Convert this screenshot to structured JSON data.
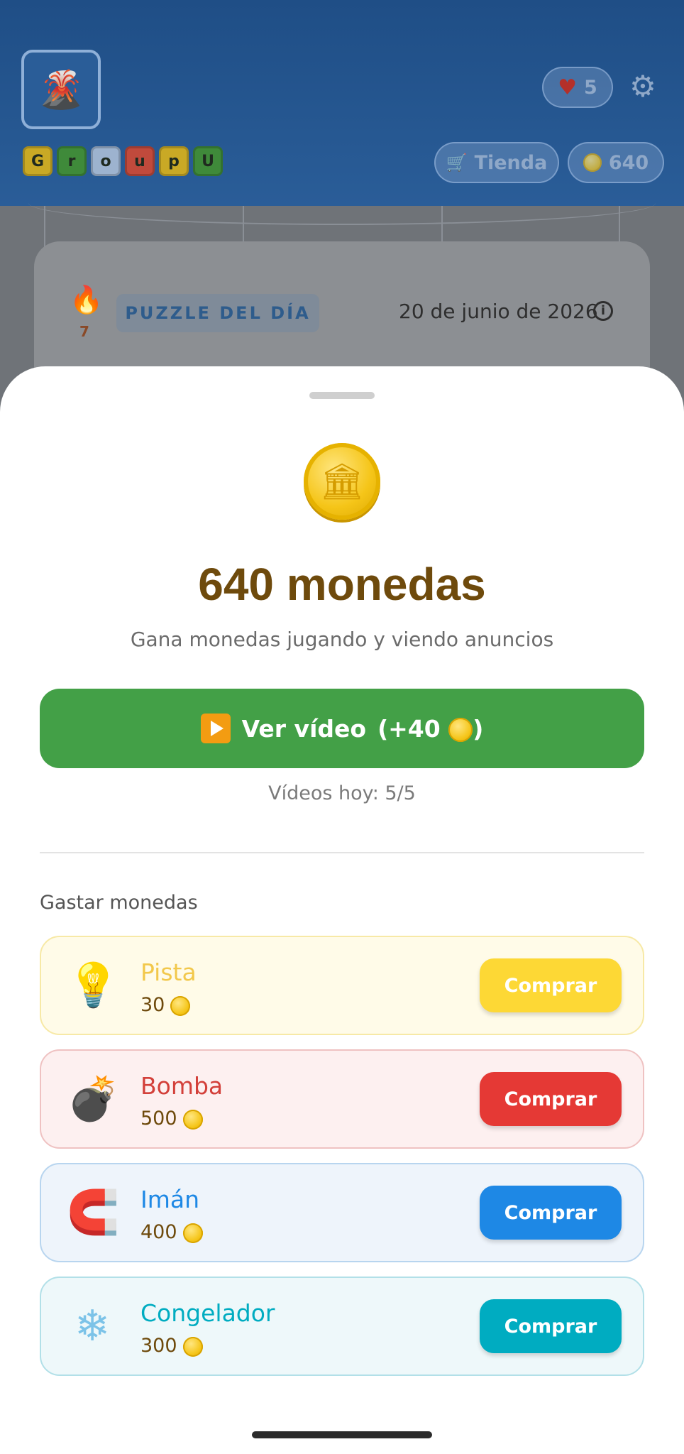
{
  "header": {
    "avatar_icon": "volcano-icon",
    "logo_letters": [
      {
        "letter": "G",
        "color": "#c9a925"
      },
      {
        "letter": "r",
        "color": "#3f8a3a"
      },
      {
        "letter": "o",
        "color": "#9db3cf"
      },
      {
        "letter": "u",
        "color": "#c04a3c"
      },
      {
        "letter": "p",
        "color": "#c9a925"
      },
      {
        "letter": "U",
        "color": "#3f8a3a"
      }
    ],
    "lives": "5",
    "shop_label": "Tienda",
    "coins": "640"
  },
  "puzzle_card": {
    "streak": "7",
    "badge": "PUZZLE DEL DÍA",
    "date": "20 de junio de 2026"
  },
  "sheet": {
    "title": "640 monedas",
    "subtitle": "Gana monedas jugando y viendo anuncios",
    "video_button_main": "Ver vídeo",
    "video_button_reward": "(+40",
    "video_button_close": ")",
    "videos_today": "Vídeos hoy: 5/5",
    "spend_label": "Gastar monedas",
    "items": [
      {
        "name": "Pista",
        "price": "30",
        "buy": "Comprar",
        "icon": "lightbulb-icon",
        "color": "#f2c84b",
        "bg": "#fffbe8",
        "border": "#f7e9a6",
        "btn": "#fdd835"
      },
      {
        "name": "Bomba",
        "price": "500",
        "buy": "Comprar",
        "icon": "bomb-icon",
        "color": "#d3403a",
        "bg": "#fdf0f0",
        "border": "#efc2c2",
        "btn": "#e53935"
      },
      {
        "name": "Imán",
        "price": "400",
        "buy": "Comprar",
        "icon": "magnet-icon",
        "color": "#1e88e5",
        "bg": "#eef4fb",
        "border": "#b8d5ef",
        "btn": "#1e88e5"
      },
      {
        "name": "Congelador",
        "price": "300",
        "buy": "Comprar",
        "icon": "snowflake-icon",
        "color": "#00acc1",
        "bg": "#eef8fa",
        "border": "#b2e0e8",
        "btn": "#00acc1"
      }
    ]
  }
}
